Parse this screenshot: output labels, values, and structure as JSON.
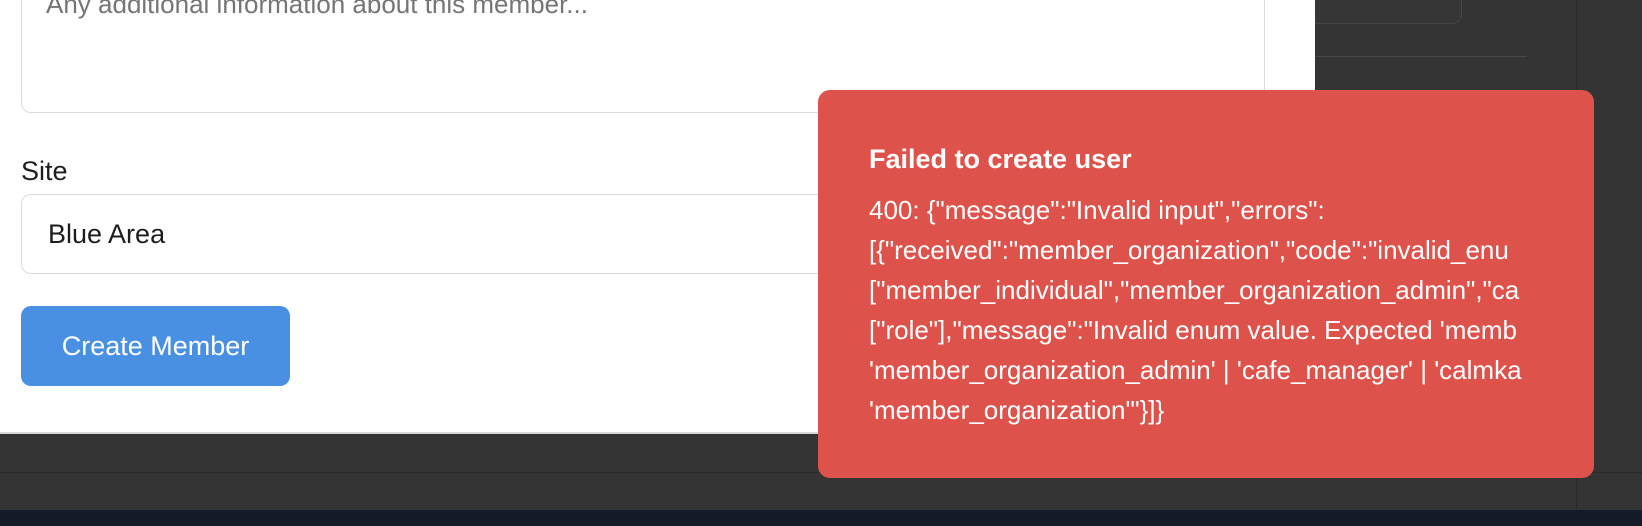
{
  "form": {
    "notes_placeholder": "Any additional information about this member...",
    "site_label": "Site",
    "site_value": "Blue Area",
    "submit_label": "Create Member"
  },
  "toast": {
    "title": "Failed to create user",
    "message_lines": [
      "400: {\"message\":\"Invalid input\",\"errors\":",
      "[{\"received\":\"member_organization\",\"code\":\"invalid_enu",
      "[\"member_individual\",\"member_organization_admin\",\"ca",
      "[\"role\"],\"message\":\"Invalid enum value. Expected 'memb",
      "'member_organization_admin' | 'cafe_manager' | 'calmka",
      "'member_organization'\"}]}"
    ]
  },
  "colors": {
    "toast_background": "#de524c",
    "button_background": "#4a90e2",
    "app_background": "#343434"
  }
}
